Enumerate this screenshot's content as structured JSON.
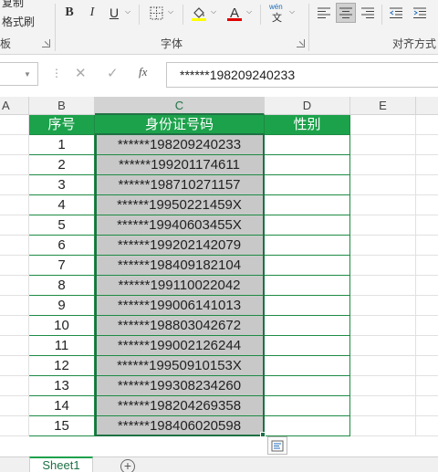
{
  "ribbon": {
    "clipboard_format_painter_cut": "复制",
    "clipboard_format_painter": "格式刷",
    "clipboard_group_label_partial": "板",
    "font_group_label": "字体",
    "alignment_group_label": "对齐方式",
    "bold_label": "B",
    "italic_label": "I",
    "underline_label": "U",
    "phonetic_label_top": "wén",
    "phonetic_label_bottom": "文",
    "font_color_letter": "A",
    "highlight_color": "#ffff00",
    "font_color": "#e00000"
  },
  "formula_bar": {
    "fx_label": "fx",
    "content": "******198209240233"
  },
  "columns": [
    {
      "letter": "A"
    },
    {
      "letter": "B"
    },
    {
      "letter": "C"
    },
    {
      "letter": "D"
    },
    {
      "letter": "E"
    }
  ],
  "table": {
    "headers": [
      "序号",
      "身份证号码",
      "性别"
    ],
    "rows": [
      {
        "no": "1",
        "id": "******198209240233",
        "gender": ""
      },
      {
        "no": "2",
        "id": "******199201174611",
        "gender": ""
      },
      {
        "no": "3",
        "id": "******198710271157",
        "gender": ""
      },
      {
        "no": "4",
        "id": "******19950221459X",
        "gender": ""
      },
      {
        "no": "5",
        "id": "******19940603455X",
        "gender": ""
      },
      {
        "no": "6",
        "id": "******199202142079",
        "gender": ""
      },
      {
        "no": "7",
        "id": "******198409182104",
        "gender": ""
      },
      {
        "no": "8",
        "id": "******199110022042",
        "gender": ""
      },
      {
        "no": "9",
        "id": "******199006141013",
        "gender": ""
      },
      {
        "no": "10",
        "id": "******198803042672",
        "gender": ""
      },
      {
        "no": "11",
        "id": "******199002126244",
        "gender": ""
      },
      {
        "no": "12",
        "id": "******19950910153X",
        "gender": ""
      },
      {
        "no": "13",
        "id": "******199308234260",
        "gender": ""
      },
      {
        "no": "14",
        "id": "******198204269358",
        "gender": ""
      },
      {
        "no": "15",
        "id": "******198406020598",
        "gender": ""
      }
    ],
    "header_color": "#1ca24b",
    "selection_color": "#c8c8c8"
  },
  "sheets": {
    "active_tab": "Sheet1",
    "add_label": "+"
  }
}
